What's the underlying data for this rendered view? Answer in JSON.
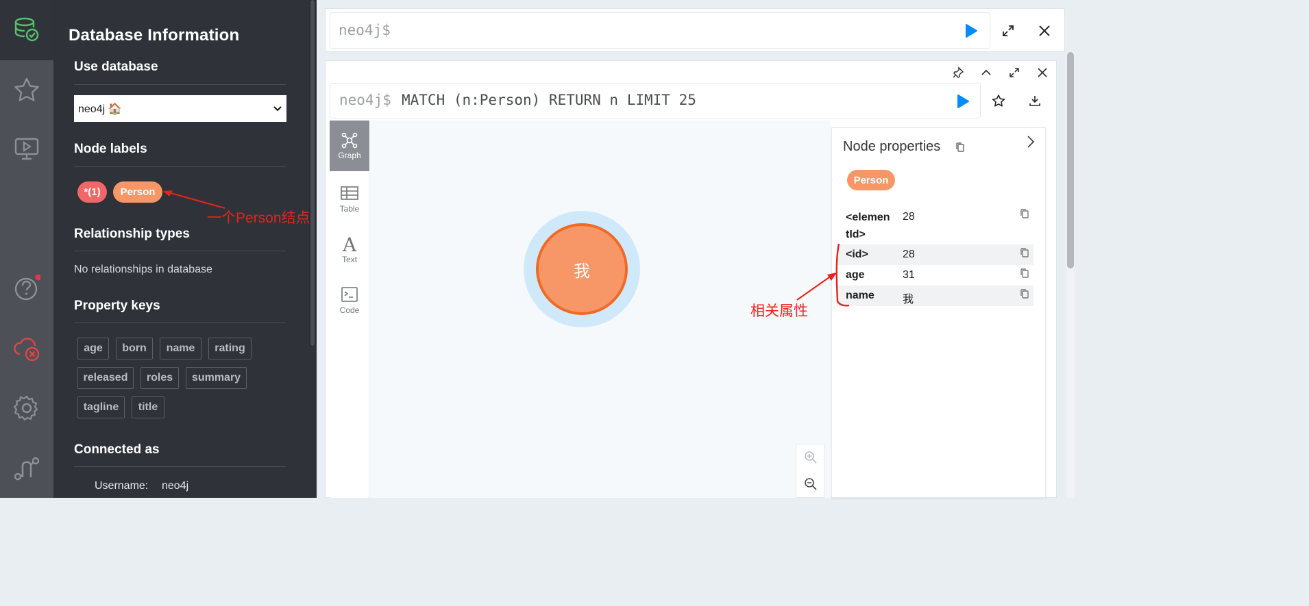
{
  "sidebar": {
    "title": "Database Information",
    "use_database": {
      "heading": "Use database",
      "selected": "neo4j 🏠"
    },
    "node_labels": {
      "heading": "Node labels",
      "items": [
        "*(1)",
        "Person"
      ]
    },
    "relationship_types": {
      "heading": "Relationship types",
      "empty_text": "No relationships in database"
    },
    "property_keys": {
      "heading": "Property keys",
      "items": [
        "age",
        "born",
        "name",
        "rating",
        "released",
        "roles",
        "summary",
        "tagline",
        "title"
      ]
    },
    "connected_as": {
      "heading": "Connected as",
      "username_label": "Username:",
      "username": "neo4j"
    }
  },
  "editor": {
    "prompt": "neo4j$"
  },
  "frame": {
    "prompt": "neo4j$",
    "query": "MATCH (n:Person) RETURN n LIMIT 25",
    "views": [
      "Graph",
      "Table",
      "Text",
      "Code"
    ],
    "node_caption": "我"
  },
  "node_properties": {
    "title": "Node properties",
    "label": "Person",
    "rows": [
      {
        "key": "<elemen\ntId>",
        "value": "28"
      },
      {
        "key": "<id>",
        "value": "28"
      },
      {
        "key": "age",
        "value": "31"
      },
      {
        "key": "name",
        "value": "我"
      }
    ]
  },
  "annotations": {
    "person_node": "一个Person结点",
    "properties": "相关属性"
  },
  "colors": {
    "accent": "#018bff",
    "person": "#f79767",
    "all_nodes": "#f16667",
    "annotation": "#e8231b"
  }
}
